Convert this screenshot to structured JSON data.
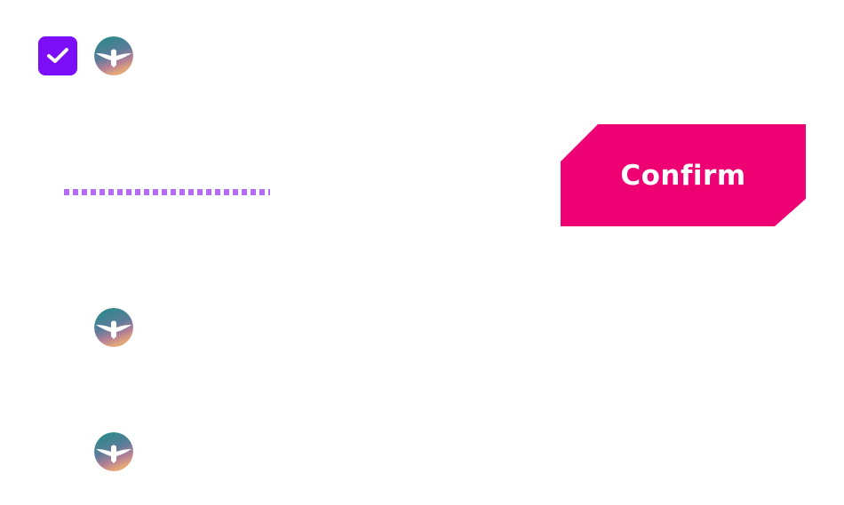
{
  "colors": {
    "checkbox_bg": "#7B0DF7",
    "checkbox_check": "#FFFFFF",
    "dotted_divider": "#B36CF2",
    "confirm_bg": "#EE0172",
    "confirm_text": "#FFFFFF",
    "avatar_gradient_top": "#1E8C86",
    "avatar_gradient_bottom": "#E0A080"
  },
  "checkbox": {
    "checked": true,
    "icon": "checkmark-icon"
  },
  "avatars": [
    {
      "icon": "bird-icon"
    },
    {
      "icon": "bird-icon"
    },
    {
      "icon": "bird-icon"
    }
  ],
  "confirm_button": {
    "label": "Confirm"
  }
}
